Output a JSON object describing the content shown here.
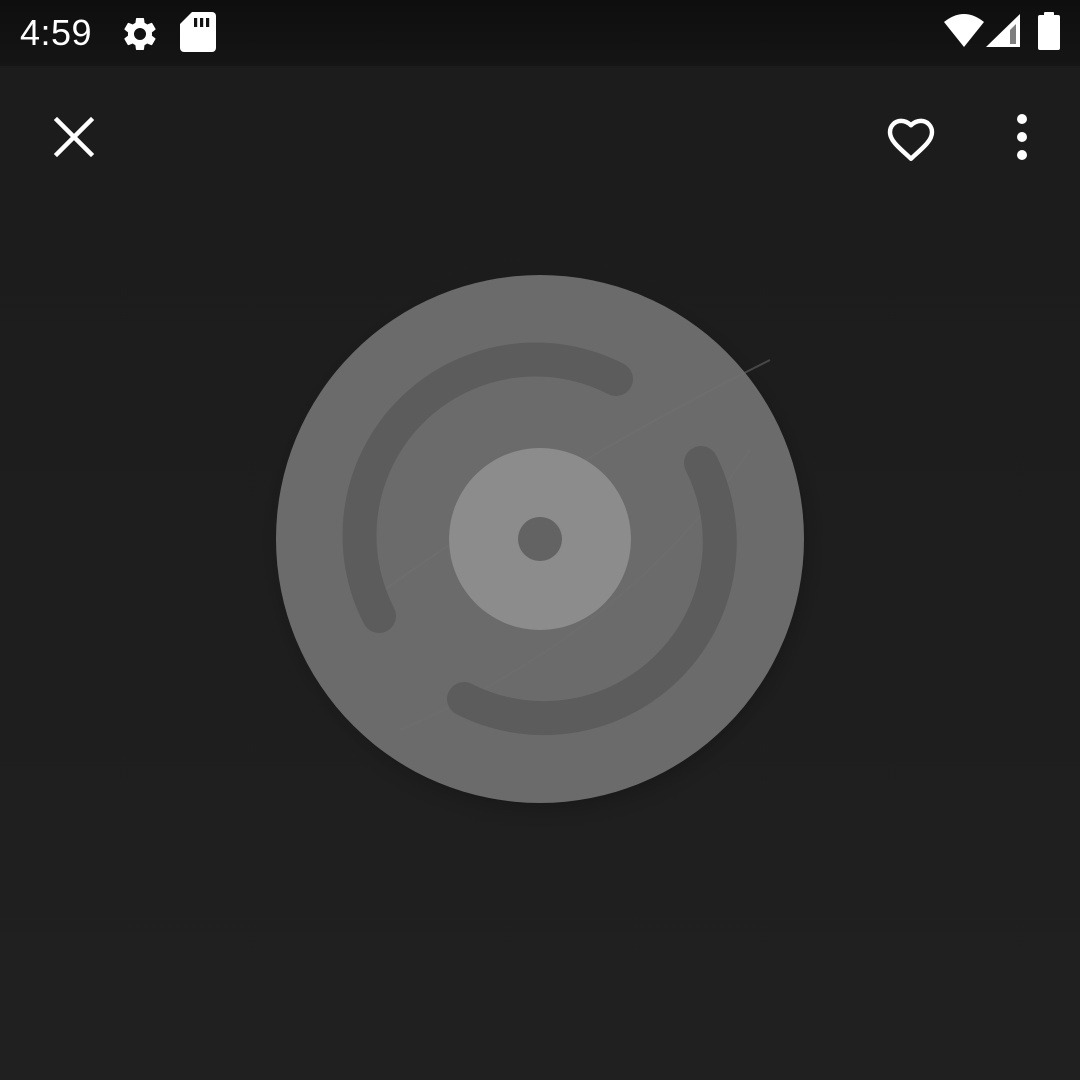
{
  "status_bar": {
    "time": "4:59",
    "icons": [
      "settings-icon",
      "sd-card-icon",
      "wifi-icon",
      "cell-signal-icon",
      "battery-icon"
    ]
  },
  "toolbar": {
    "close_icon": "close-icon",
    "favorite_icon": "heart-outline-icon",
    "more_icon": "more-vert-icon"
  },
  "album_art": {
    "placeholder_icon": "vinyl-disc-icon"
  },
  "colors": {
    "background": "#1f1f1f",
    "status_bar": "#111111",
    "icon": "#ffffff",
    "disc": "#6b6b6b",
    "disc_groove": "#5c5c5c",
    "disc_label": "#8c8c8c"
  }
}
